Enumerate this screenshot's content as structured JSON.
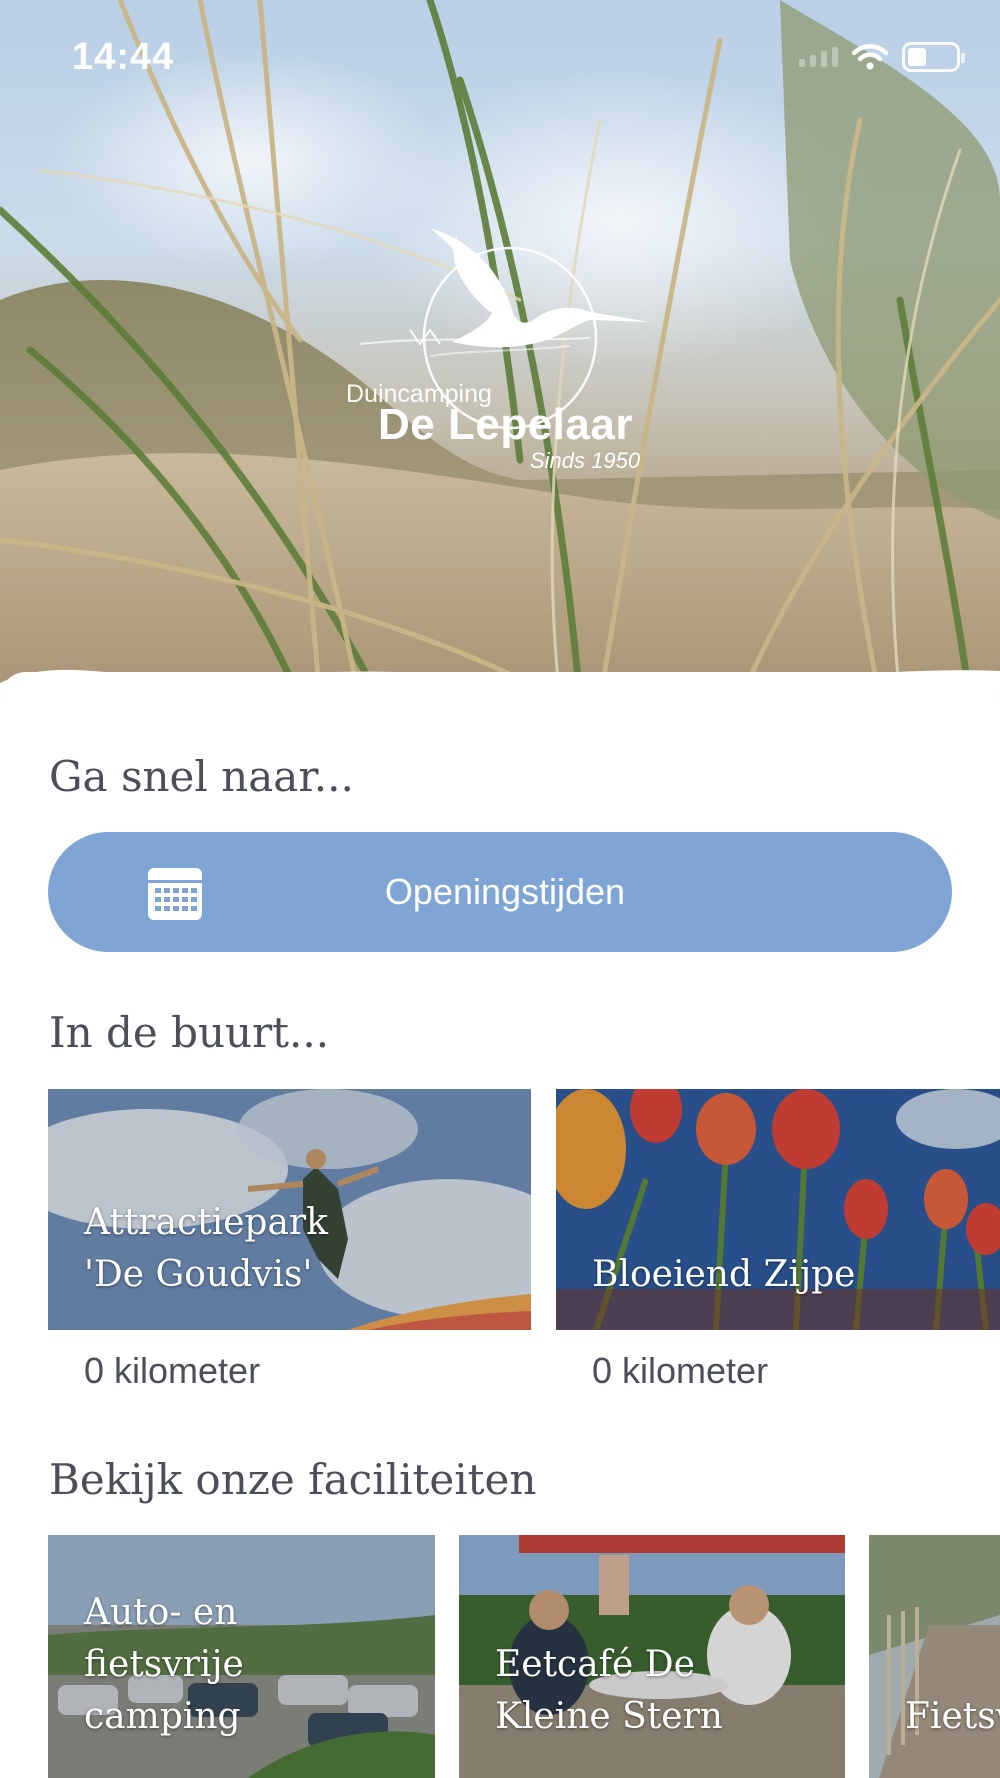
{
  "status_bar": {
    "time": "14:44"
  },
  "logo": {
    "subtitle": "Duincamping",
    "name": "De Lepelaar",
    "since": "Sinds 1950"
  },
  "quick_nav": {
    "title": "Ga snel naar...",
    "button_label": "Openingstijden",
    "button_icon": "calendar-icon"
  },
  "nearby": {
    "title": "In de buurt...",
    "items": [
      {
        "title": "Attractiepark 'De Goudvis'",
        "distance": "0 kilometer"
      },
      {
        "title": "Bloeiend Zijpe",
        "distance": "0 kilometer"
      }
    ]
  },
  "facilities": {
    "title": "Bekijk onze faciliteiten",
    "items": [
      {
        "title": "Auto- en fietsvrije camping"
      },
      {
        "title": "Eetcafé De Kleine Stern"
      },
      {
        "title": "Fietsv"
      }
    ]
  },
  "colors": {
    "accent": "#7fa5d5",
    "text": "#4a4f58"
  }
}
